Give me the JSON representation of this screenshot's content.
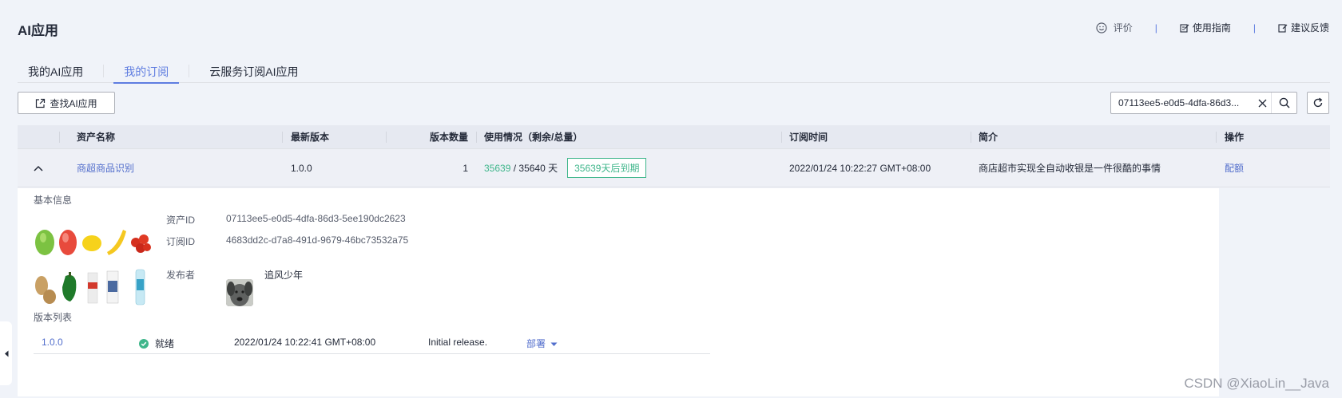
{
  "page": {
    "title": "AI应用"
  },
  "top_links": {
    "rate": "评价",
    "guide": "使用指南",
    "feedback": "建议反馈",
    "separator": "|"
  },
  "tabs": [
    {
      "label": "我的AI应用",
      "active": false
    },
    {
      "label": "我的订阅",
      "active": true
    },
    {
      "label": "云服务订阅AI应用",
      "active": false
    }
  ],
  "toolbar": {
    "find_label": "查找AI应用",
    "search_value": "07113ee5-e0d5-4dfa-86d3..."
  },
  "table": {
    "headers": [
      "资产名称",
      "最新版本",
      "版本数量",
      "使用情况（剩余/总量）",
      "订阅时间",
      "简介",
      "操作"
    ],
    "row": {
      "name": "商超商品识别",
      "latest_version": "1.0.0",
      "version_count": "1",
      "usage_remaining": "35639",
      "usage_sep": " / ",
      "usage_total": "35640 天",
      "expire_badge": "35639天后到期",
      "subscribe_time": "2022/01/24 10:22:27 GMT+08:00",
      "intro": "商店超市实现全自动收银是一件很酷的事情",
      "action": "配额"
    }
  },
  "detail": {
    "basic_title": "基本信息",
    "asset_id_label": "资产ID",
    "asset_id": "07113ee5-e0d5-4dfa-86d3-5ee190dc2623",
    "subscribe_id_label": "订阅ID",
    "subscribe_id": "4683dd2c-d7a8-491d-9679-46bc73532a75",
    "publisher_label": "发布者",
    "publisher": "追风少年",
    "version_list_title": "版本列表",
    "versions": [
      {
        "version": "1.0.0",
        "status": "就绪",
        "time": "2022/01/24 10:22:41 GMT+08:00",
        "desc": "Initial release.",
        "deploy": "部署"
      }
    ]
  },
  "watermark": "CSDN @XiaoLin__Java",
  "colors": {
    "accent": "#5e7ce0",
    "link": "#526ecc",
    "success": "#3fb68b",
    "background": "#f0f3f9"
  }
}
